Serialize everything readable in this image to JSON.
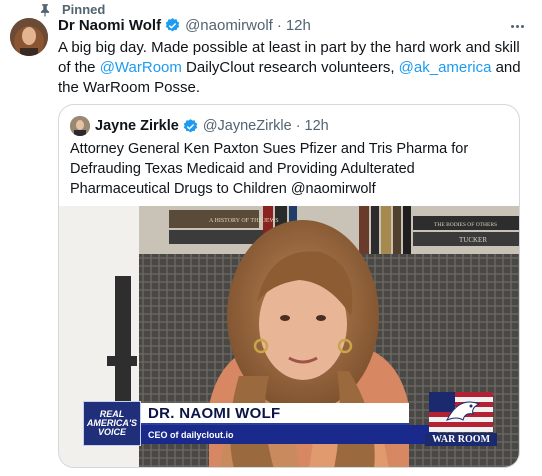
{
  "pinned": {
    "label": "Pinned"
  },
  "tweet": {
    "display_name": "Dr Naomi Wolf",
    "handle": "@naomirwolf",
    "separator": "·",
    "time": "12h",
    "text_parts": {
      "p1": "A big big day. Made possible at least in part by the hard work and skill of the ",
      "m1": "@WarRoom",
      "p2": " DailyClout research volunteers, ",
      "m2": "@ak_america",
      "p3": " and the WarRoom Posse."
    }
  },
  "quote": {
    "display_name": "Jayne Zirkle",
    "handle": "@JayneZirkle",
    "separator": "·",
    "time": "12h",
    "text": "Attorney General Ken Paxton Sues Pfizer and Tris Pharma for Defrauding Texas Medicaid and Providing Adulterated Pharmaceutical Drugs to Children @naomirwolf"
  },
  "video_overlay": {
    "logo_lines": [
      "REAL",
      "AMERICA'S",
      "VOICE"
    ],
    "name": "DR. NAOMI WOLF",
    "subtitle": "CEO of dailyclout.io",
    "bug": "WAR ROOM",
    "book_spine_1": "A HISTORY OF THE JEWS",
    "book_spine_2": "THE BODIES OF OTHERS",
    "book_spine_3": "TUCKER"
  },
  "colors": {
    "accent": "#1d9bf0",
    "secondary_text": "#536471",
    "border": "#cfd9de",
    "verified": "#1d9bf0"
  },
  "icons": [
    "pin-icon",
    "verified-badge-icon",
    "more-options-icon"
  ]
}
